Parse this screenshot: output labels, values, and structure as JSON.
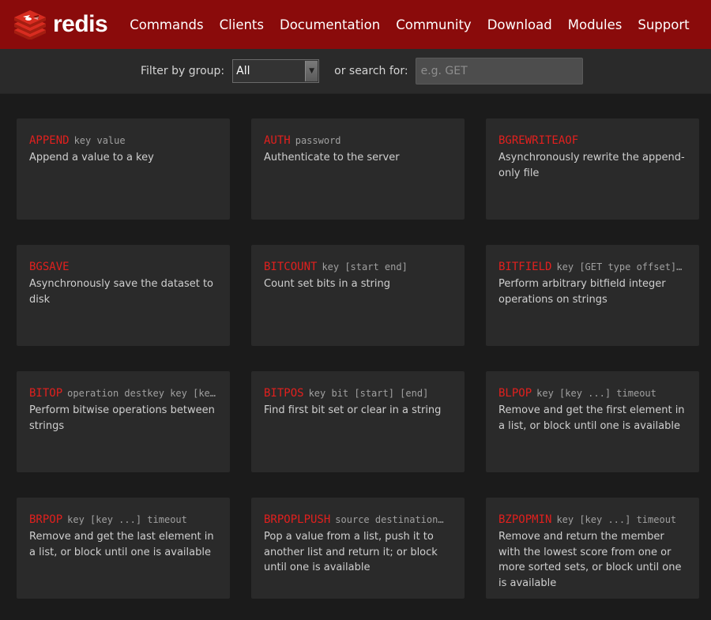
{
  "header": {
    "logo_text": "redis",
    "brand_color": "#8a0b0b",
    "nav": [
      "Commands",
      "Clients",
      "Documentation",
      "Community",
      "Download",
      "Modules",
      "Support"
    ]
  },
  "filter": {
    "group_label": "Filter by group:",
    "group_value": "All",
    "search_label": "or search for:",
    "search_placeholder": "e.g. GET",
    "search_value": ""
  },
  "commands": [
    {
      "name": "APPEND",
      "args": "key value",
      "summary": "Append a value to a key"
    },
    {
      "name": "AUTH",
      "args": "password",
      "summary": "Authenticate to the server"
    },
    {
      "name": "BGREWRITEAOF",
      "args": "",
      "summary": "Asynchronously rewrite the append-only file"
    },
    {
      "name": "BGSAVE",
      "args": "",
      "summary": "Asynchronously save the dataset to disk"
    },
    {
      "name": "BITCOUNT",
      "args": "key [start end]",
      "summary": "Count set bits in a string"
    },
    {
      "name": "BITFIELD",
      "args": "key [GET type offset]…",
      "summary": "Perform arbitrary bitfield integer operations on strings"
    },
    {
      "name": "BITOP",
      "args": "operation destkey key [ke…",
      "summary": "Perform bitwise operations between strings"
    },
    {
      "name": "BITPOS",
      "args": "key bit [start] [end]",
      "summary": "Find first bit set or clear in a string"
    },
    {
      "name": "BLPOP",
      "args": "key [key ...] timeout",
      "summary": "Remove and get the first element in a list, or block until one is available"
    },
    {
      "name": "BRPOP",
      "args": "key [key ...] timeout",
      "summary": "Remove and get the last element in a list, or block until one is available"
    },
    {
      "name": "BRPOPLPUSH",
      "args": "source destination…",
      "summary": "Pop a value from a list, push it to another list and return it; or block until one is available"
    },
    {
      "name": "BZPOPMIN",
      "args": "key [key ...] timeout",
      "summary": "Remove and return the member with the lowest score from one or more sorted sets, or block until one is available"
    }
  ]
}
